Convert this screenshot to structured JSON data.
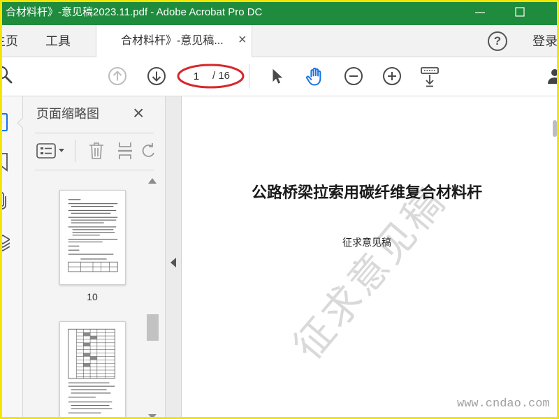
{
  "window": {
    "title": "合材料杆》-意见稿2023.11.pdf - Adobe Acrobat Pro DC",
    "control_icons": [
      "minimize-icon",
      "maximize-icon"
    ]
  },
  "colors": {
    "titlebar_bg": "#1f8b3d",
    "frame_border": "#f3e500",
    "accent_blue": "#1473e6",
    "annotation_red": "#d7272c",
    "watermark_gray": "#d9d9d9"
  },
  "tabs": {
    "home_label": "主页",
    "tools_label": "工具",
    "document_label": "合材料杆》-意见稿...",
    "document_close": "×"
  },
  "header": {
    "help_label": "?",
    "signin_label": "登录"
  },
  "toolbar": {
    "icons": [
      "search-icon",
      "previous-page-icon",
      "next-page-icon",
      "select-pointer-icon",
      "hand-tool-icon",
      "zoom-out-icon",
      "zoom-in-icon",
      "page-display-icon",
      "account-icon"
    ],
    "active_tool": "hand-tool-icon",
    "page_current": "1",
    "page_total": "/ 16",
    "annotation": "red-ellipse-around-page-number"
  },
  "left_nav": {
    "icons": [
      "page-thumbnails-icon",
      "bookmarks-icon",
      "attachments-icon",
      "layers-icon"
    ],
    "active": "page-thumbnails-icon"
  },
  "thumbnails_panel": {
    "title": "页面缩略图",
    "close": "×",
    "tools": [
      "thumbnail-options-icon",
      "delete-page-icon",
      "insert-page-icon",
      "rotate-page-icon"
    ],
    "pages": [
      {
        "label": "10"
      }
    ]
  },
  "document": {
    "title": "公路桥梁拉索用碳纤维复合材料杆",
    "subtitle": "征求意见稿",
    "diagonal_watermark": "征求意见稿",
    "site_watermark": "www.cndao.com"
  }
}
